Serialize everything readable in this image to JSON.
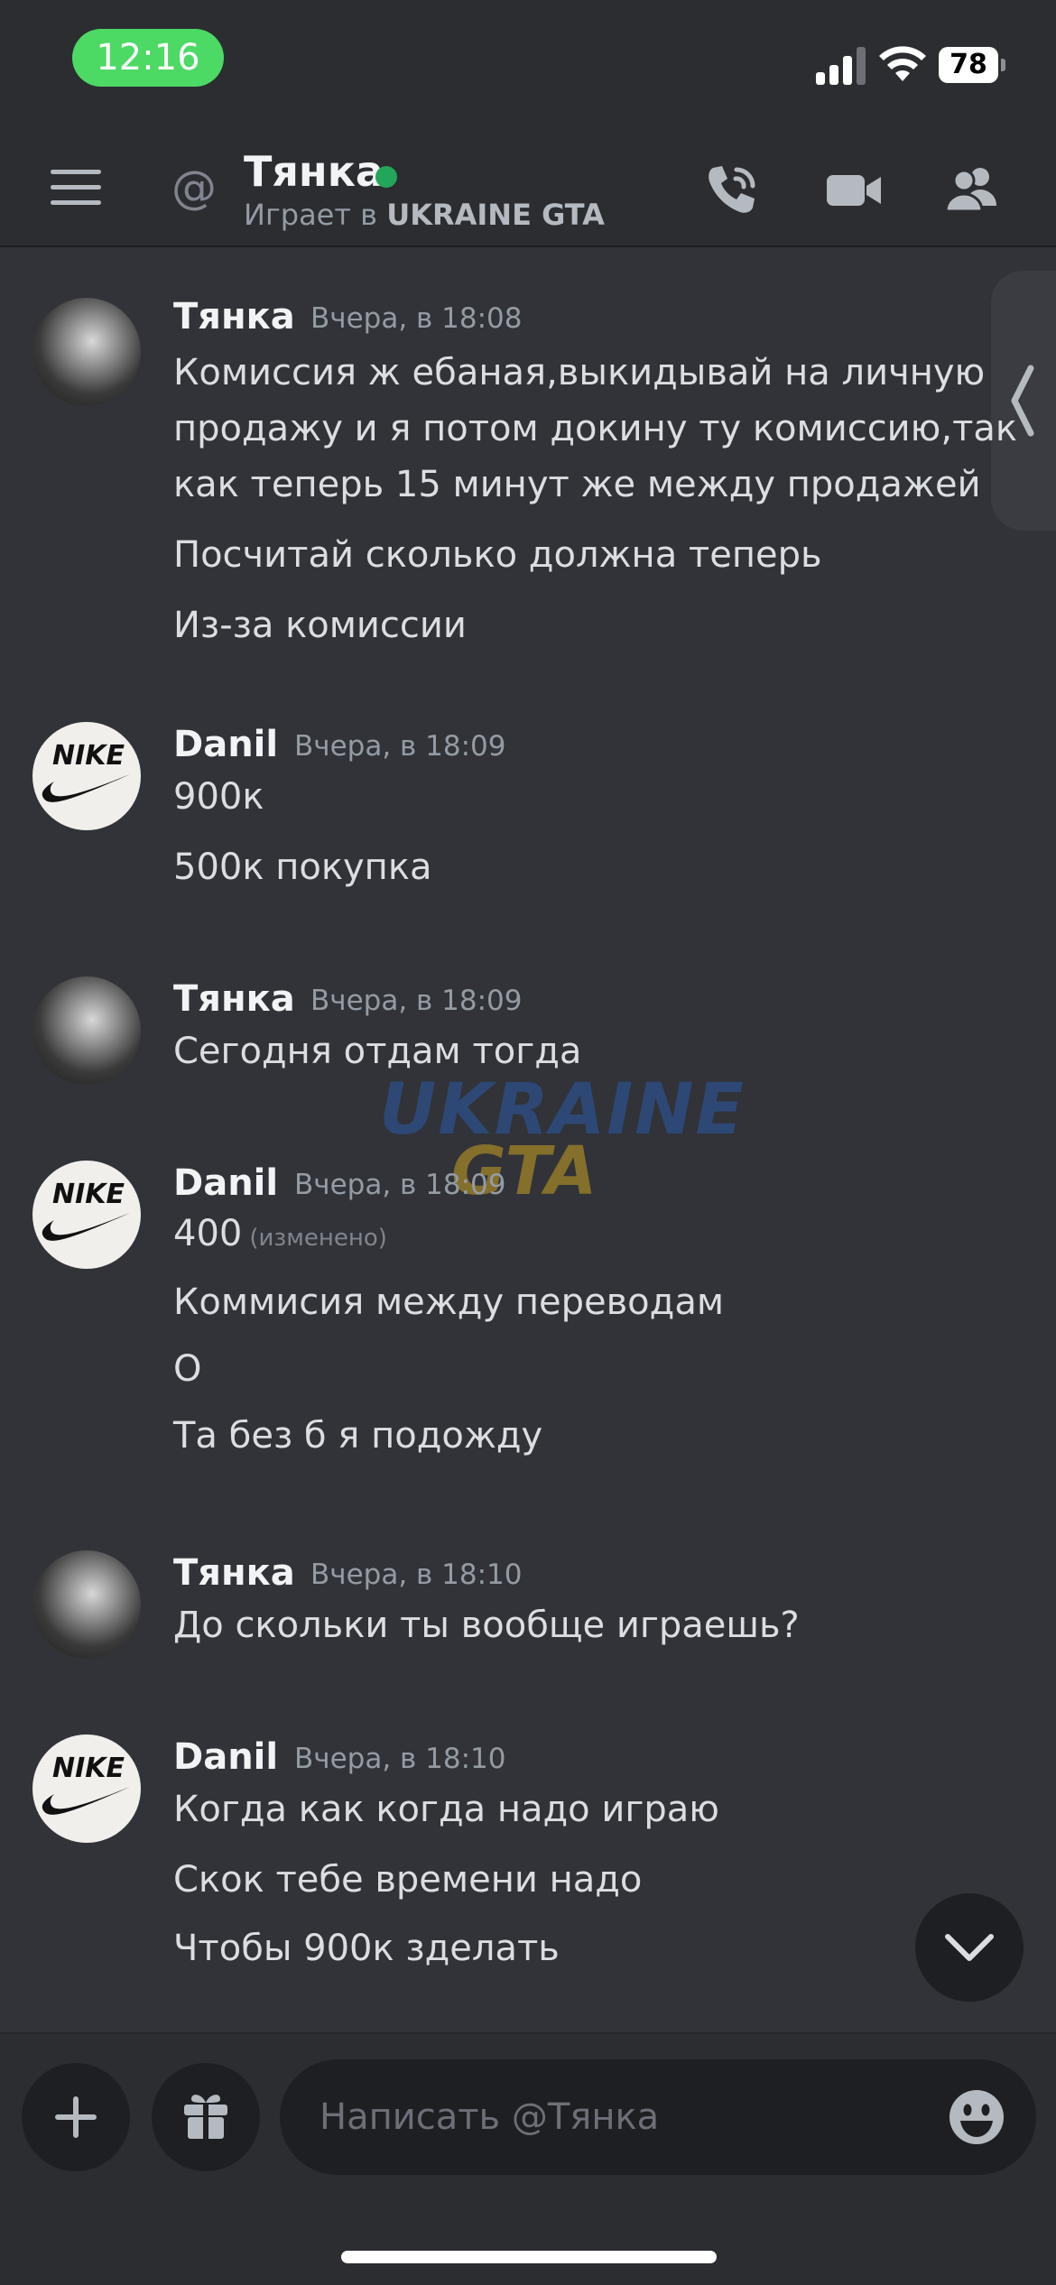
{
  "status_bar": {
    "time": "12:16",
    "battery": "78"
  },
  "header": {
    "at_symbol": "@",
    "channel_name": "Тянка",
    "status_prefix": "Играет в",
    "status_game": "UKRAINE GTA"
  },
  "watermark": {
    "line1": "UKRAINE",
    "line2": "GTA"
  },
  "messages": [
    {
      "author": "Тянка",
      "time": "Вчера, в 18:08",
      "lines": [
        "Комиссия ж ебаная,выкидывай на личную",
        "продажу и я потом докину ту комиссию,так",
        "как теперь 15 минут же между продажей",
        "Посчитай сколько должна теперь",
        "Из-за комиссии"
      ]
    },
    {
      "author": "Danil",
      "time": "Вчера, в 18:09",
      "lines": [
        "900к",
        "500к покупка"
      ]
    },
    {
      "author": "Тянка",
      "time": "Вчера, в 18:09",
      "lines": [
        "Сегодня отдам тогда"
      ]
    },
    {
      "author": "Danil",
      "time": "Вчера, в 18:09",
      "lines": [
        "400",
        "Коммисия между переводам",
        "О",
        "Та без б я подожду"
      ],
      "edited_label": "(изменено)"
    },
    {
      "author": "Тянка",
      "time": "Вчера, в 18:10",
      "lines": [
        "До скольки ты вообще играешь?"
      ]
    },
    {
      "author": "Danil",
      "time": "Вчера, в 18:10",
      "lines": [
        "Когда как когда надо играю",
        "Скок тебе времени надо",
        "Чтобы 900к зделать"
      ]
    }
  ],
  "avatars": {
    "nike_text": "NIKE"
  },
  "composer": {
    "placeholder": "Написать @Тянка"
  },
  "colors": {
    "background": "#313338",
    "header_bg": "#2b2d31",
    "online": "#23a55a",
    "time_pill": "#4cd964"
  },
  "icons": [
    "menu-icon",
    "at-icon",
    "phone-call-icon",
    "video-camera-icon",
    "members-icon",
    "chevron-left-icon",
    "chevron-down-icon",
    "plus-icon",
    "gift-icon",
    "emoji-icon"
  ]
}
